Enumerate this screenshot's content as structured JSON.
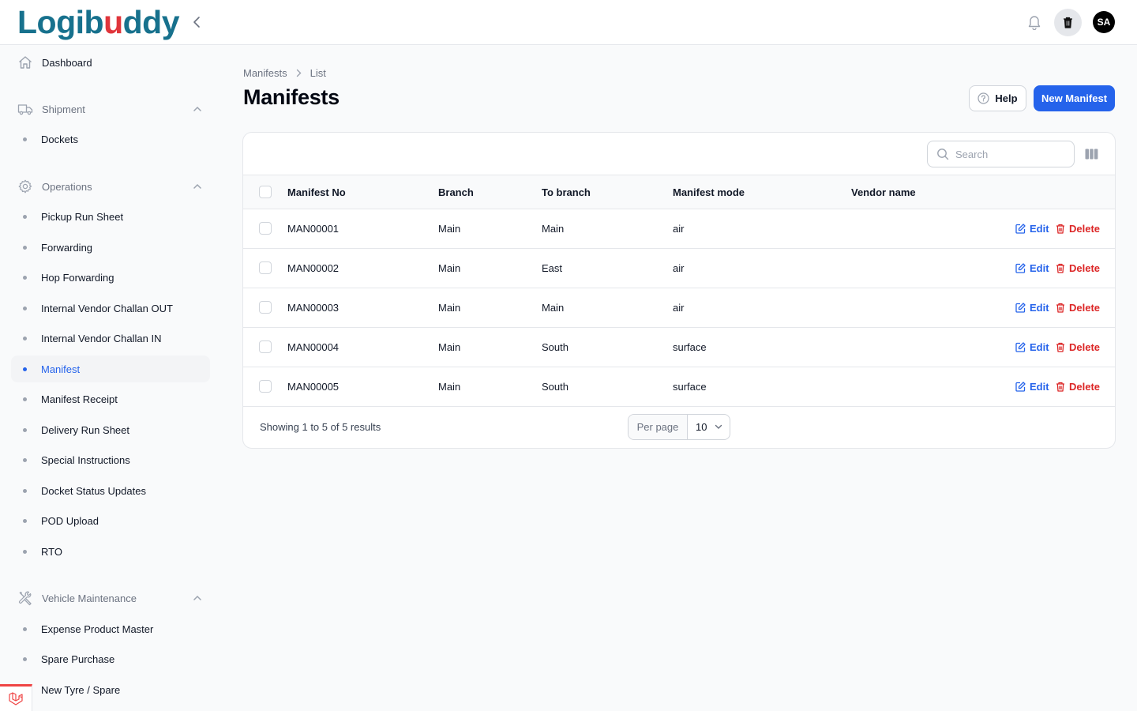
{
  "brand": {
    "name_prefix": "Logib",
    "name_dot": "u",
    "name_suffix": "ddy"
  },
  "header": {
    "avatar_initials": "SA"
  },
  "sidebar": {
    "dashboard_label": "Dashboard",
    "groups": [
      {
        "label": "Shipment",
        "items": [
          "Dockets"
        ]
      },
      {
        "label": "Operations",
        "items": [
          "Pickup Run Sheet",
          "Forwarding",
          "Hop Forwarding",
          "Internal Vendor Challan OUT",
          "Internal Vendor Challan IN",
          "Manifest",
          "Manifest Receipt",
          "Delivery Run Sheet",
          "Special Instructions",
          "Docket Status Updates",
          "POD Upload",
          "RTO"
        ]
      },
      {
        "label": "Vehicle Maintenance",
        "items": [
          "Expense Product Master",
          "Spare Purchase",
          "New Tyre / Spare"
        ]
      }
    ],
    "active_item": "Manifest"
  },
  "breadcrumb": [
    "Manifests",
    "List"
  ],
  "page": {
    "title": "Manifests",
    "help_label": "Help",
    "new_label": "New Manifest"
  },
  "table": {
    "search_placeholder": "Search",
    "columns": [
      "Manifest No",
      "Branch",
      "To branch",
      "Manifest mode",
      "Vendor name"
    ],
    "rows": [
      {
        "no": "MAN00001",
        "branch": "Main",
        "to_branch": "Main",
        "mode": "air",
        "vendor": ""
      },
      {
        "no": "MAN00002",
        "branch": "Main",
        "to_branch": "East",
        "mode": "air",
        "vendor": ""
      },
      {
        "no": "MAN00003",
        "branch": "Main",
        "to_branch": "Main",
        "mode": "air",
        "vendor": ""
      },
      {
        "no": "MAN00004",
        "branch": "Main",
        "to_branch": "South",
        "mode": "surface",
        "vendor": ""
      },
      {
        "no": "MAN00005",
        "branch": "Main",
        "to_branch": "South",
        "mode": "surface",
        "vendor": ""
      }
    ],
    "edit_label": "Edit",
    "delete_label": "Delete",
    "footer_text": "Showing 1 to 5 of 5 results",
    "per_page_label": "Per page",
    "per_page_value": "10"
  },
  "colors": {
    "primary": "#2563eb",
    "danger": "#dc2626",
    "brand": "#17718d",
    "brand_dot": "#e0353b"
  }
}
